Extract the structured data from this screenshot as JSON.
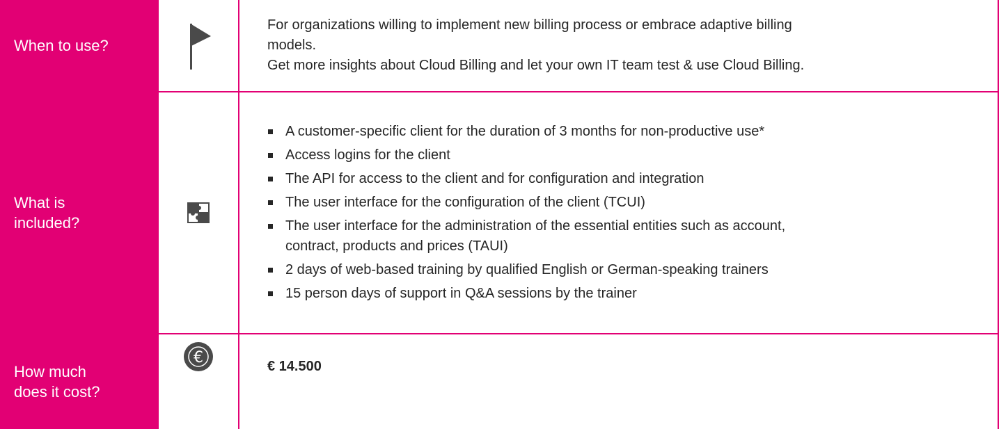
{
  "rows": {
    "when": {
      "label": "When to use?",
      "icon": "flag-icon",
      "lines": [
        "For organizations willing to implement new billing process or embrace adaptive billing",
        "models.",
        "Get more insights about Cloud Billing and let your own IT team test & use Cloud Billing."
      ]
    },
    "included": {
      "label_line1": "What is",
      "label_line2": "included?",
      "icon": "puzzle-icon",
      "items": [
        "A customer-specific client for the duration of 3 months for non-productive use*",
        "Access logins for the client",
        "The API for access to the client and for configuration and integration",
        "The user interface for the configuration of the client (TCUI)",
        "The user interface for the administration of the essential entities such as account,",
        "contract, products and prices (TAUI)",
        "2 days of web-based training by qualified English or German-speaking trainers",
        "15 person days of support in Q&A sessions by the trainer"
      ]
    },
    "cost": {
      "label_line1": "How much",
      "label_line2": "does it cost?",
      "icon": "euro-icon",
      "price": "€ 14.500"
    }
  },
  "colors": {
    "accent": "#e20074",
    "text": "#262626",
    "icon": "#4a4a4a"
  }
}
